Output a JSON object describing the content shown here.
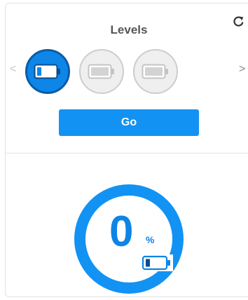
{
  "header": {
    "title": "Levels"
  },
  "nav": {
    "prev": "<",
    "next": ">"
  },
  "levels": [
    {
      "state": "active",
      "icon": "battery-low-icon"
    },
    {
      "state": "locked",
      "icon": "battery-icon"
    },
    {
      "state": "locked",
      "icon": "battery-icon"
    }
  ],
  "actions": {
    "go_label": "Go"
  },
  "progress": {
    "value": "0",
    "unit": "%"
  },
  "colors": {
    "accent": "#1293f3",
    "accent_dark": "#0a5ca8",
    "inactive": "#cdcdcd"
  }
}
